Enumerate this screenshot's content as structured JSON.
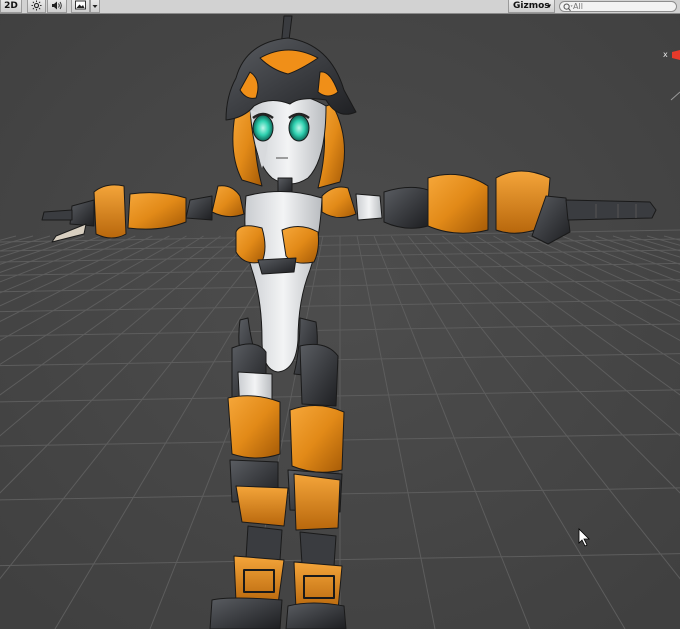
{
  "toolbar": {
    "mode_2d_label": "2D",
    "lighting_icon": "sun-icon",
    "audio_icon": "speaker-icon",
    "effects_icon": "image-icon",
    "effects_dropdown_icon": "caret-down-icon",
    "gizmos_label": "Gizmos",
    "gizmos_dropdown_icon": "caret-down-icon",
    "search_placeholder": "All",
    "search_icon": "search-icon"
  },
  "scene": {
    "gizmo_axis_label": "x",
    "model_icon": "robot-character",
    "cursor_icon": "mouse-pointer-icon"
  },
  "colors": {
    "toolbar_bg": "#d2d2d2",
    "scene_bg": "#474747",
    "grid_line": "#5d5d5d",
    "armor_orange": "#e28a18",
    "armor_dark": "#2b2d30",
    "body_white": "#e4e6e8",
    "eye_teal": "#2fd1b0",
    "gizmo_red": "#e83a2a"
  }
}
